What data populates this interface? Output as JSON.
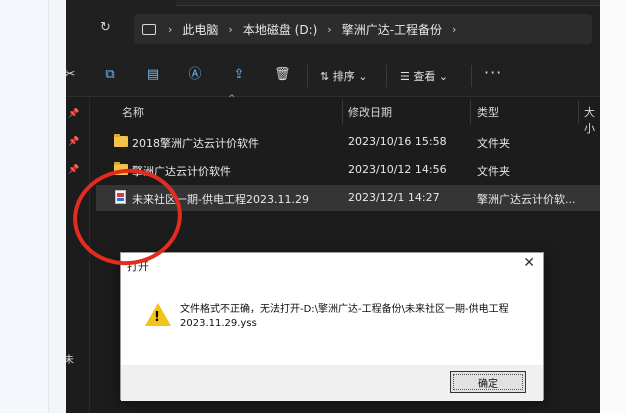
{
  "breadcrumb": [
    "此电脑",
    "本地磁盘 (D:)",
    "擎洲广达-工程备份"
  ],
  "toolbar": {
    "sort_label": "排序",
    "view_label": "查看",
    "more_label": "···"
  },
  "columns": {
    "name": "名称",
    "date": "修改日期",
    "type": "类型",
    "size": "大小"
  },
  "files": [
    {
      "name": "2018擎洲广达云计价软件",
      "date": "2023/10/16 15:58",
      "type": "文件夹",
      "icon": "folder-icon"
    },
    {
      "name": "擎洲广达云计价软件",
      "date": "2023/10/12 14:56",
      "type": "文件夹",
      "icon": "folder-icon"
    },
    {
      "name": "未来社区一期-供电工程2023.11.29",
      "date": "2023/12/1 14:27",
      "type": "擎洲广达云计价软...",
      "icon": "document-icon"
    }
  ],
  "nav": {
    "partial_label": "未"
  },
  "dialog": {
    "title": "打开",
    "message": "文件格式不正确，无法打开-D:\\擎洲广达-工程备份\\未来社区一期-供电工程2023.11.29.yss",
    "ok_label": "确定",
    "close_label": "✕"
  },
  "colors": {
    "explorer_bg": "#1c1c1c",
    "accent": "#6fb7ff",
    "annotation": "#e32b20",
    "warning": "#f2c417"
  }
}
